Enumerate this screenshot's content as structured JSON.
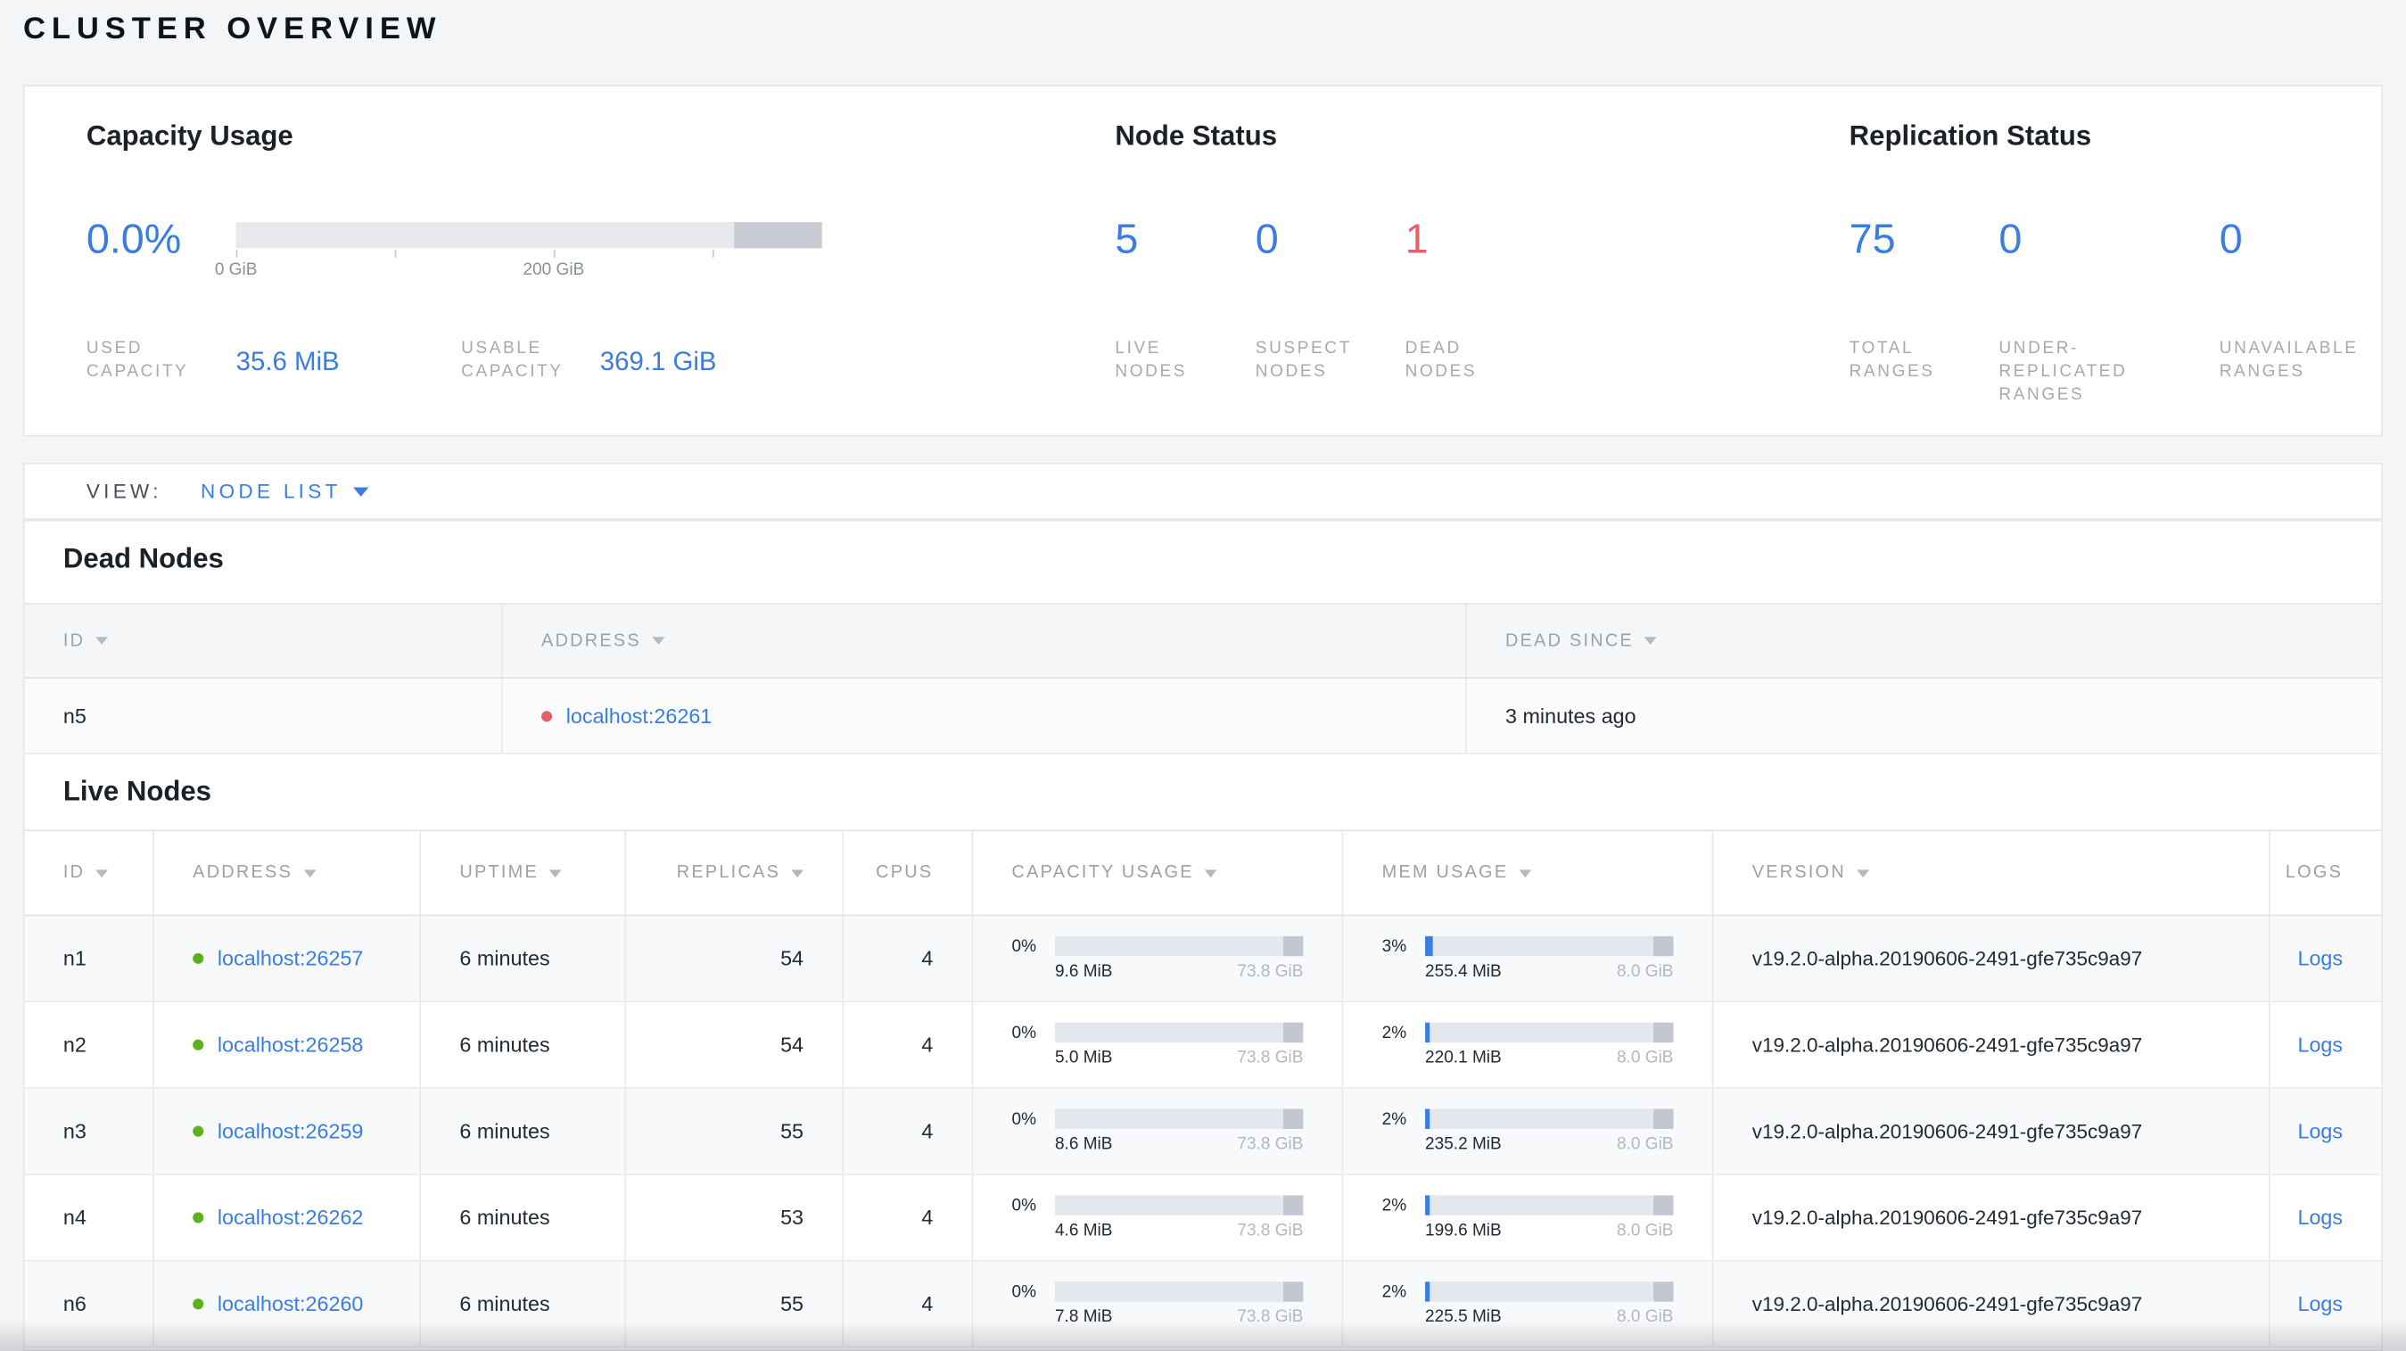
{
  "page_title": "CLUSTER OVERVIEW",
  "colors": {
    "accent_blue": "#3a7de1",
    "danger_red": "#e2616d",
    "healthy_green": "#5bb31b"
  },
  "summary": {
    "capacity": {
      "title": "Capacity Usage",
      "percent": "0.0%",
      "tick_labels": [
        "0 GiB",
        "200 GiB"
      ],
      "used_label": "USED CAPACITY",
      "used_value": "35.6 MiB",
      "usable_label": "USABLE CAPACITY",
      "usable_value": "369.1 GiB"
    },
    "node_status": {
      "title": "Node Status",
      "items": [
        {
          "value": "5",
          "label": "LIVE NODES",
          "color": "#3a7de1"
        },
        {
          "value": "0",
          "label": "SUSPECT NODES",
          "color": "#3a7de1"
        },
        {
          "value": "1",
          "label": "DEAD NODES",
          "color": "#e2616d"
        }
      ]
    },
    "replication_status": {
      "title": "Replication Status",
      "items": [
        {
          "value": "75",
          "label": "TOTAL RANGES",
          "color": "#3a7de1"
        },
        {
          "value": "0",
          "label": "UNDER-REPLICATED RANGES",
          "color": "#3a7de1"
        },
        {
          "value": "0",
          "label": "UNAVAILABLE RANGES",
          "color": "#3a7de1"
        }
      ]
    }
  },
  "view_bar": {
    "label": "VIEW:",
    "selected": "NODE LIST"
  },
  "dead_nodes": {
    "title": "Dead Nodes",
    "columns": [
      "ID",
      "ADDRESS",
      "DEAD SINCE"
    ],
    "rows": [
      {
        "id": "n5",
        "address": "localhost:26261",
        "dead_since": "3 minutes ago"
      }
    ]
  },
  "live_nodes": {
    "title": "Live Nodes",
    "columns": [
      "ID",
      "ADDRESS",
      "UPTIME",
      "REPLICAS",
      "CPUS",
      "CAPACITY USAGE",
      "MEM USAGE",
      "VERSION",
      "LOGS"
    ],
    "rows": [
      {
        "id": "n1",
        "address": "localhost:26257",
        "uptime": "6 minutes",
        "replicas": "54",
        "cpus": "4",
        "cap_pct": "0%",
        "cap_used": "9.6 MiB",
        "cap_total": "73.8 GiB",
        "mem_pct": "3%",
        "mem_used": "255.4 MiB",
        "mem_total": "8.0 GiB",
        "version": "v19.2.0-alpha.20190606-2491-gfe735c9a97",
        "logs_label": "Logs"
      },
      {
        "id": "n2",
        "address": "localhost:26258",
        "uptime": "6 minutes",
        "replicas": "54",
        "cpus": "4",
        "cap_pct": "0%",
        "cap_used": "5.0 MiB",
        "cap_total": "73.8 GiB",
        "mem_pct": "2%",
        "mem_used": "220.1 MiB",
        "mem_total": "8.0 GiB",
        "version": "v19.2.0-alpha.20190606-2491-gfe735c9a97",
        "logs_label": "Logs"
      },
      {
        "id": "n3",
        "address": "localhost:26259",
        "uptime": "6 minutes",
        "replicas": "55",
        "cpus": "4",
        "cap_pct": "0%",
        "cap_used": "8.6 MiB",
        "cap_total": "73.8 GiB",
        "mem_pct": "2%",
        "mem_used": "235.2 MiB",
        "mem_total": "8.0 GiB",
        "version": "v19.2.0-alpha.20190606-2491-gfe735c9a97",
        "logs_label": "Logs"
      },
      {
        "id": "n4",
        "address": "localhost:26262",
        "uptime": "6 minutes",
        "replicas": "53",
        "cpus": "4",
        "cap_pct": "0%",
        "cap_used": "4.6 MiB",
        "cap_total": "73.8 GiB",
        "mem_pct": "2%",
        "mem_used": "199.6 MiB",
        "mem_total": "8.0 GiB",
        "version": "v19.2.0-alpha.20190606-2491-gfe735c9a97",
        "logs_label": "Logs"
      },
      {
        "id": "n6",
        "address": "localhost:26260",
        "uptime": "6 minutes",
        "replicas": "55",
        "cpus": "4",
        "cap_pct": "0%",
        "cap_used": "7.8 MiB",
        "cap_total": "73.8 GiB",
        "mem_pct": "2%",
        "mem_used": "225.5 MiB",
        "mem_total": "8.0 GiB",
        "version": "v19.2.0-alpha.20190606-2491-gfe735c9a97",
        "logs_label": "Logs"
      }
    ]
  }
}
